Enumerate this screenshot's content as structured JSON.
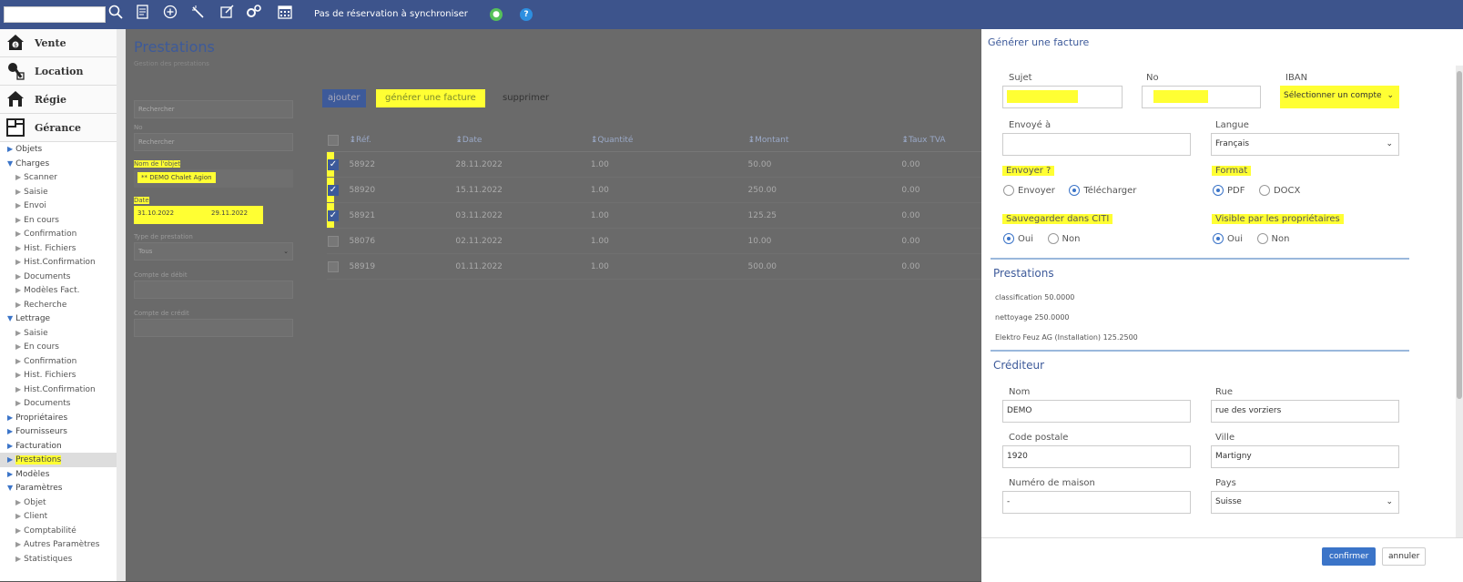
{
  "topbar": {
    "sync_text": "Pas de réservation à synchroniser"
  },
  "modules": [
    {
      "label": "Vente"
    },
    {
      "label": "Location"
    },
    {
      "label": "Régie"
    },
    {
      "label": "Gérance"
    }
  ],
  "tree": [
    {
      "label": "Objets",
      "level": 1,
      "open": false
    },
    {
      "label": "Charges",
      "level": 1,
      "open": true
    },
    {
      "label": "Scanner",
      "level": 2
    },
    {
      "label": "Saisie",
      "level": 2
    },
    {
      "label": "Envoi",
      "level": 2
    },
    {
      "label": "En cours",
      "level": 2
    },
    {
      "label": "Confirmation",
      "level": 2
    },
    {
      "label": "Hist. Fichiers",
      "level": 2
    },
    {
      "label": "Hist.Confirmation",
      "level": 2
    },
    {
      "label": "Documents",
      "level": 2
    },
    {
      "label": "Modèles Fact.",
      "level": 2
    },
    {
      "label": "Recherche",
      "level": 2
    },
    {
      "label": "Lettrage",
      "level": 1,
      "open": true
    },
    {
      "label": "Saisie",
      "level": 2
    },
    {
      "label": "En cours",
      "level": 2
    },
    {
      "label": "Confirmation",
      "level": 2
    },
    {
      "label": "Hist. Fichiers",
      "level": 2
    },
    {
      "label": "Hist.Confirmation",
      "level": 2
    },
    {
      "label": "Documents",
      "level": 2
    },
    {
      "label": "Propriétaires",
      "level": 1,
      "open": false
    },
    {
      "label": "Fournisseurs",
      "level": 1,
      "open": false
    },
    {
      "label": "Facturation",
      "level": 1,
      "open": false
    },
    {
      "label": "Prestations",
      "level": 1,
      "open": false,
      "selected": true
    },
    {
      "label": "Modèles",
      "level": 1,
      "open": false
    },
    {
      "label": "Paramètres",
      "level": 1,
      "open": true
    },
    {
      "label": "Objet",
      "level": 2
    },
    {
      "label": "Client",
      "level": 2
    },
    {
      "label": "Comptabilité",
      "level": 2
    },
    {
      "label": "Autres Paramètres",
      "level": 2
    },
    {
      "label": "Statistiques",
      "level": 2
    }
  ],
  "main": {
    "title": "Prestations",
    "subtitle": "Gestion des prestations",
    "filters": {
      "search_placeholder": "Rechercher",
      "no_label": "No",
      "no_placeholder": "Rechercher",
      "object_label": "Nom de l'objet",
      "object_value": "** DEMO Chalet Agion",
      "date_label": "Date",
      "date_from": "31.10.2022",
      "date_to": "29.11.2022",
      "type_label": "Type de prestation",
      "type_value": "Tous",
      "debit_label": "Compte de débit",
      "credit_label": "Compte de crédit"
    },
    "buttons": {
      "add": "ajouter",
      "generate": "générer une facture",
      "delete": "supprimer"
    },
    "columns": [
      "Réf.",
      "Date",
      "Quantité",
      "Montant",
      "Taux TVA"
    ],
    "rows": [
      {
        "checked": true,
        "ref": "58922",
        "date": "28.11.2022",
        "qty": "1.00",
        "amount": "50.00",
        "vat": "0.00"
      },
      {
        "checked": true,
        "ref": "58920",
        "date": "15.11.2022",
        "qty": "1.00",
        "amount": "250.00",
        "vat": "0.00"
      },
      {
        "checked": true,
        "ref": "58921",
        "date": "03.11.2022",
        "qty": "1.00",
        "amount": "125.25",
        "vat": "0.00"
      },
      {
        "checked": false,
        "ref": "58076",
        "date": "02.11.2022",
        "qty": "1.00",
        "amount": "10.00",
        "vat": "0.00"
      },
      {
        "checked": false,
        "ref": "58919",
        "date": "01.11.2022",
        "qty": "1.00",
        "amount": "500.00",
        "vat": "0.00"
      }
    ]
  },
  "panel": {
    "title": "Générer une facture",
    "sujet_label": "Sujet",
    "no_label": "No",
    "iban_label": "IBAN",
    "iban_value": "Sélectionner un compte",
    "envoye_label": "Envoyé à",
    "langue_label": "Langue",
    "langue_value": "Français",
    "envoyer_label": "Envoyer ?",
    "envoyer_opt1": "Envoyer",
    "envoyer_opt2": "Télécharger",
    "format_label": "Format",
    "format_opt1": "PDF",
    "format_opt2": "DOCX",
    "sauv_label": "Sauvegarder dans CITI",
    "visible_label": "Visible par les propriétaires",
    "oui": "Oui",
    "non": "Non",
    "prest_header": "Prestations",
    "prest_lines": [
      "classification 50.0000",
      "nettoyage 250.0000",
      "Elektro Feuz AG (Installation) 125.2500"
    ],
    "cred_header": "Créditeur",
    "nom_label": "Nom",
    "nom_value": "DEMO",
    "rue_label": "Rue",
    "rue_value": "rue des vorziers",
    "cp_label": "Code postale",
    "cp_value": "1920",
    "ville_label": "Ville",
    "ville_value": "Martigny",
    "num_label": "Numéro de maison",
    "num_value": "-",
    "pays_label": "Pays",
    "pays_value": "Suisse",
    "confirm": "confirmer",
    "cancel": "annuler"
  },
  "colors": {
    "topbar": "#3d548c",
    "highlight": "#ffff33",
    "accent": "#3d5a9a"
  }
}
